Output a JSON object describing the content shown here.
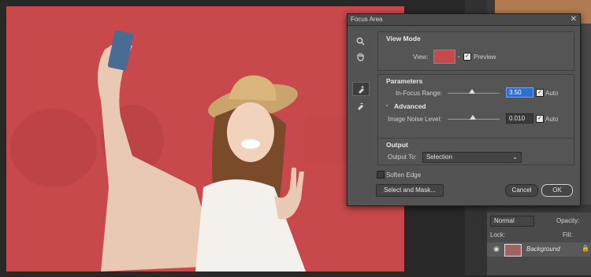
{
  "dialog": {
    "title": "Focus Area",
    "close_glyph": "✕",
    "view_mode": {
      "heading": "View Mode",
      "view_label": "View:",
      "preview_label": "Preview",
      "preview_checked": true
    },
    "parameters": {
      "heading": "Parameters",
      "in_focus_range_label": "In-Focus Range:",
      "in_focus_range_value": "3.50",
      "in_focus_auto_label": "Auto",
      "in_focus_auto_checked": true,
      "advanced_label": "Advanced",
      "noise_label": "Image Noise Level:",
      "noise_value": "0.010",
      "noise_auto_label": "Auto",
      "noise_auto_checked": true
    },
    "output": {
      "heading": "Output",
      "output_to_label": "Output To:",
      "output_to_value": "Selection"
    },
    "soften_edge_label": "Soften Edge",
    "soften_edge_checked": false,
    "select_and_mask_label": "Select and Mask...",
    "cancel_label": "Cancel",
    "ok_label": "OK"
  },
  "layers": {
    "blend_mode": "Normal",
    "opacity_label": "Opacity:",
    "lock_label": "Lock:",
    "fill_label": "Fill:",
    "layer_name": "Background"
  },
  "colors": {
    "mask_red": "#c7494b",
    "dialog_bg": "#535353",
    "accent": "#2f6fd1"
  },
  "icons": [
    "zoom-icon",
    "hand-icon",
    "add-focus-brush-icon",
    "subtract-focus-brush-icon",
    "eye-icon",
    "lock-icon"
  ]
}
